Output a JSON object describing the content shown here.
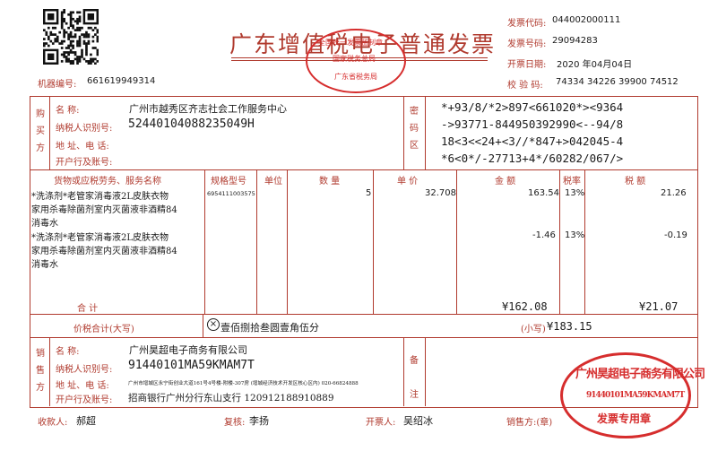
{
  "header": {
    "title": "广东增值税电子普通发票",
    "machine_label": "机器编号:",
    "machine_no": "661619949314",
    "right": [
      {
        "label": "发票代码:",
        "value": "044002000111"
      },
      {
        "label": "发票号码:",
        "value": "29094283"
      },
      {
        "label": "开票日期:",
        "value": "2020 年04月04日"
      },
      {
        "label": "校  验  码:",
        "value": "74334 34226 39900 74512"
      }
    ]
  },
  "buyer": {
    "section_label": "购买方",
    "name_label": "名          称:",
    "name": "广州市越秀区齐志社会工作服务中心",
    "taxid_label": "纳税人识别号:",
    "taxid": "52440104088235049H",
    "addr_label": "地  址、电  话:",
    "bank_label": "开户行及账号:"
  },
  "cipher": {
    "section_label": "密码区",
    "lines": [
      "*+93/8/*2>897<661020*><9364",
      "->93771-844950392990<--94/8",
      "18<3<<24+<3//*847+>042045-4",
      "*6<0*/-27713+4*/60282/067/>"
    ]
  },
  "items": {
    "headers": {
      "name": "货物或应税劳务、服务名称",
      "spec": "规格型号",
      "unit": "单位",
      "qty": "数  量",
      "price": "单  价",
      "amount": "金  额",
      "rate": "税率",
      "tax": "税  额"
    },
    "rows": [
      {
        "name_lines": [
          "*洗涤剂*老管家消毒液2L皮肤衣物",
          "家用杀毒除菌剂室内灭菌液非酒精84",
          "消毒水"
        ],
        "spec": "6954111003575",
        "qty": "5",
        "price": "32.708",
        "amount": "163.54",
        "rate": "13%",
        "tax": "21.26"
      },
      {
        "name_lines": [
          "*洗涤剂*老管家消毒液2L皮肤衣物",
          "家用杀毒除菌剂室内灭菌液非酒精84",
          "消毒水"
        ],
        "spec": "",
        "qty": "",
        "price": "",
        "amount": "-1.46",
        "rate": "13%",
        "tax": "-0.19"
      }
    ],
    "total_label": "合          计",
    "total_amount": "¥162.08",
    "total_tax": "¥21.07"
  },
  "sum": {
    "label": "价税合计(大写)",
    "words": "壹佰捌拾叁圆壹角伍分",
    "small_label": "(小写)",
    "small_value": "¥183.15"
  },
  "seller": {
    "section_label": "销售方",
    "name_label": "名          称:",
    "name": "广州昊超电子商务有限公司",
    "taxid_label": "纳税人识别号:",
    "taxid": "91440101MA59KMAM7T",
    "addr_label": "地  址、电  话:",
    "addr": "广州市增城区永宁街创业大道161号4号楼-附楼-307房 (增城经济技术开发区核心区内) 020-66824888",
    "bank_label": "开户行及账号:",
    "bank": "招商银行广州分行东山支行 120912188910889",
    "remark_label": "备注"
  },
  "footer": {
    "payee_label": "收款人:",
    "payee": "郝超",
    "review_label": "复核:",
    "review": "李扬",
    "drawer_label": "开票人:",
    "drawer": "吴绍冰",
    "seller_label": "销售方:(章)"
  },
  "stamps": {
    "tax_bureau_top": "全国统一发票监制章",
    "tax_bureau_mid": "国家税务总局",
    "tax_bureau_bottom": "广东省税务局",
    "company_name": "广州昊超电子商务有限公司",
    "company_taxid": "91440101MA59KMAM7T",
    "company_bottom": "发票专用章"
  },
  "colors": {
    "frame": "#b03a2e",
    "stamp": "#d62d2d"
  }
}
